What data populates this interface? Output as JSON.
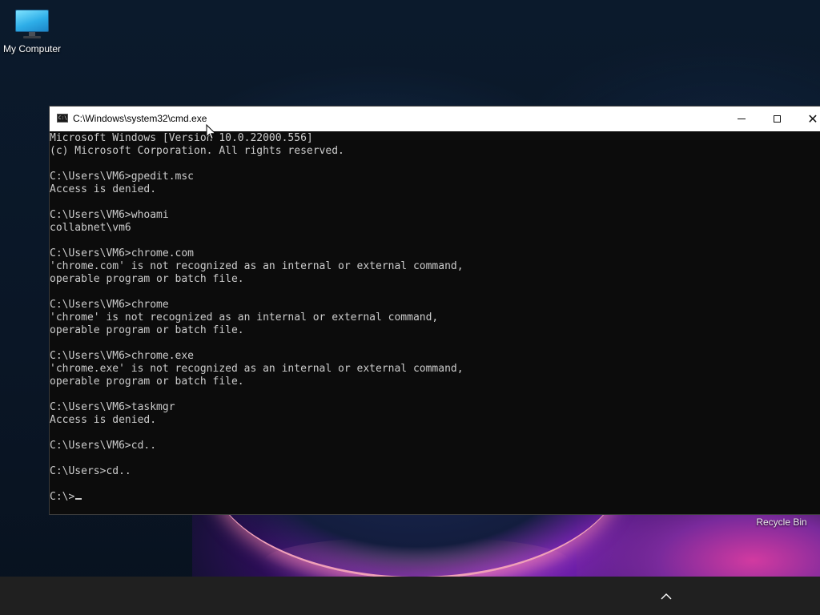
{
  "desktop": {
    "icons": [
      {
        "label": "My Computer",
        "icon": "monitor-icon"
      },
      {
        "label": "Recycle Bin",
        "icon": "recycle-bin-icon"
      }
    ]
  },
  "window": {
    "title": "C:\\Windows\\system32\\cmd.exe",
    "icon": "cmd-icon",
    "icon_glyph": "C:\\",
    "controls": {
      "minimize": "minimize-icon",
      "maximize": "maximize-icon",
      "close": "close-icon",
      "close_glyph": "✕"
    }
  },
  "console": {
    "lines": [
      "Microsoft Windows [Version 10.0.22000.556]",
      "(c) Microsoft Corporation. All rights reserved.",
      "",
      "C:\\Users\\VM6>gpedit.msc",
      "Access is denied.",
      "",
      "C:\\Users\\VM6>whoami",
      "collabnet\\vm6",
      "",
      "C:\\Users\\VM6>chrome.com",
      "'chrome.com' is not recognized as an internal or external command,",
      "operable program or batch file.",
      "",
      "C:\\Users\\VM6>chrome",
      "'chrome' is not recognized as an internal or external command,",
      "operable program or batch file.",
      "",
      "C:\\Users\\VM6>chrome.exe",
      "'chrome.exe' is not recognized as an internal or external command,",
      "operable program or batch file.",
      "",
      "C:\\Users\\VM6>taskmgr",
      "Access is denied.",
      "",
      "C:\\Users\\VM6>cd..",
      "",
      "C:\\Users>cd..",
      ""
    ],
    "prompt": "C:\\>"
  },
  "taskbar": {
    "tray_icon": "chevron-up-icon"
  },
  "colors": {
    "console_bg": "#0c0c0c",
    "console_text": "#cccccc",
    "titlebar_bg": "#ffffff",
    "taskbar_bg": "#202020"
  }
}
